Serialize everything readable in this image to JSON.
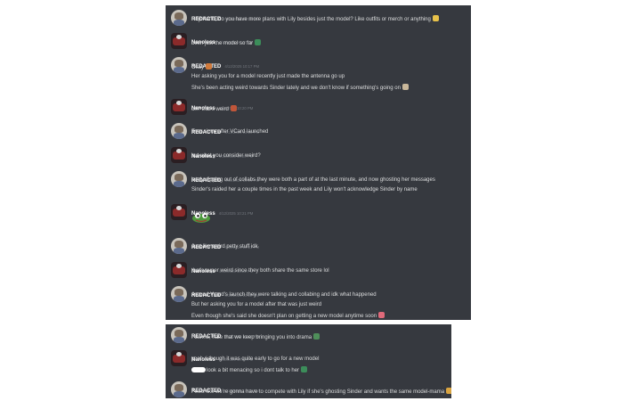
{
  "colors": {
    "panel_bg": "#36393f",
    "username": "#ffffff",
    "message_text": "#dcddde",
    "timestamp": "#72767d"
  },
  "messages_top": [
    {
      "user": "REDACTED",
      "time": "4/12/2025 10:16 PM",
      "avatar": "redacted",
      "lines": [
        {
          "text": "Hey Nano, do you have more plans with Lily besides just the model? Like outfits or merch or anything",
          "emoji": "notes-emoji"
        }
      ]
    },
    {
      "user": "Nanoless",
      "time": "4/12/2025 10:17 PM",
      "avatar": "nanoless",
      "lines": [
        {
          "text": "been just the model so far",
          "emoji": "fish-emoji"
        }
      ]
    },
    {
      "user": "REDACTED",
      "time": "4/12/2025 10:17 PM",
      "avatar": "redacted",
      "lines": [
        {
          "text": "Okay",
          "emoji": "dog-emoji"
        },
        {
          "text": "Her asking you for a model recently just made the antenna go up"
        },
        {
          "text": "She's been acting weird towards Sinder lately and we don't know if something's going on",
          "emoji": "face-emoji"
        }
      ]
    },
    {
      "user": "Nanoless",
      "time": "4/12/2025 10:20 PM",
      "avatar": "nanoless",
      "lines": [
        {
          "text": "oh? that's weird",
          "emoji": "thinking-emoji"
        }
      ]
    },
    {
      "user": "REDACTED",
      "time": "4/12/2025 10:20 PM",
      "avatar": "redacted",
      "lines": [
        {
          "text": "Ever since after VCard launched"
        }
      ]
    },
    {
      "user": "Nanoless",
      "time": "4/12/2025 10:20 PM",
      "avatar": "nanoless",
      "lines": [
        {
          "text": "but what you consider weird?"
        }
      ]
    },
    {
      "user": "REDACTED",
      "time": "4/12/2025 10:21 PM",
      "avatar": "redacted",
      "lines": [
        {
          "text": "lately dipping out of collabs they were both a part of at the last minute, and now ghosting her messages"
        },
        {
          "text": "Sinder's raided her a couple times in the past week and Lily won't acknowledge Sinder by name"
        }
      ]
    },
    {
      "user": "Nanoless",
      "time": "4/12/2025 10:21 PM",
      "avatar": "nanoless",
      "sticker": "pepe-sticker",
      "lines": []
    },
    {
      "user": "REDACTED",
      "time": "4/12/2025 10:21 PM",
      "avatar": "redacted",
      "lines": [
        {
          "text": "Just like weird petty stuff idk"
        }
      ]
    },
    {
      "user": "Nanoless",
      "time": "4/12/2025 10:22 PM",
      "avatar": "nanoless",
      "lines": [
        {
          "text": "that's super weird since they both share the same store lol"
        }
      ]
    },
    {
      "user": "REDACTED",
      "time": "4/12/2025 10:22 PM",
      "avatar": "redacted",
      "lines": [
        {
          "text": "Around Vcard's launch they were talking and collabing and idk what happened"
        },
        {
          "text": "But her asking you for a model after that was just weird"
        },
        {
          "text": "Even though she's said she doesn't plan on getting a new model anytime soon",
          "emoji": "cake-emoji"
        }
      ]
    }
  ],
  "messages_bottom": [
    {
      "user": "REDACTED",
      "time": "4/12/2025 10:24 PM",
      "avatar": "redacted",
      "lines": [
        {
          "text": "I dunno, hate that we keep bringing you into drama",
          "emoji": "globe-emoji"
        }
      ]
    },
    {
      "user": "Nanoless",
      "time": "4/12/2025 10:24 PM",
      "avatar": "nanoless",
      "lines": [
        {
          "text": "yeah, i though it was quite early to go for a new model"
        },
        {
          "text": "look a bit menacing so i dont talk to her",
          "emoji": "fish-emoji",
          "prefix_blot": true
        }
      ]
    },
    {
      "user": "REDACTED",
      "time": "4/12/2025 10:25 PM",
      "avatar": "redacted",
      "lines": [
        {
          "text": "Feels like we're gonna have to compete with Lily if she's ghosting Sinder and wants the same model-mama",
          "emoji": "paw-emoji"
        }
      ]
    }
  ]
}
